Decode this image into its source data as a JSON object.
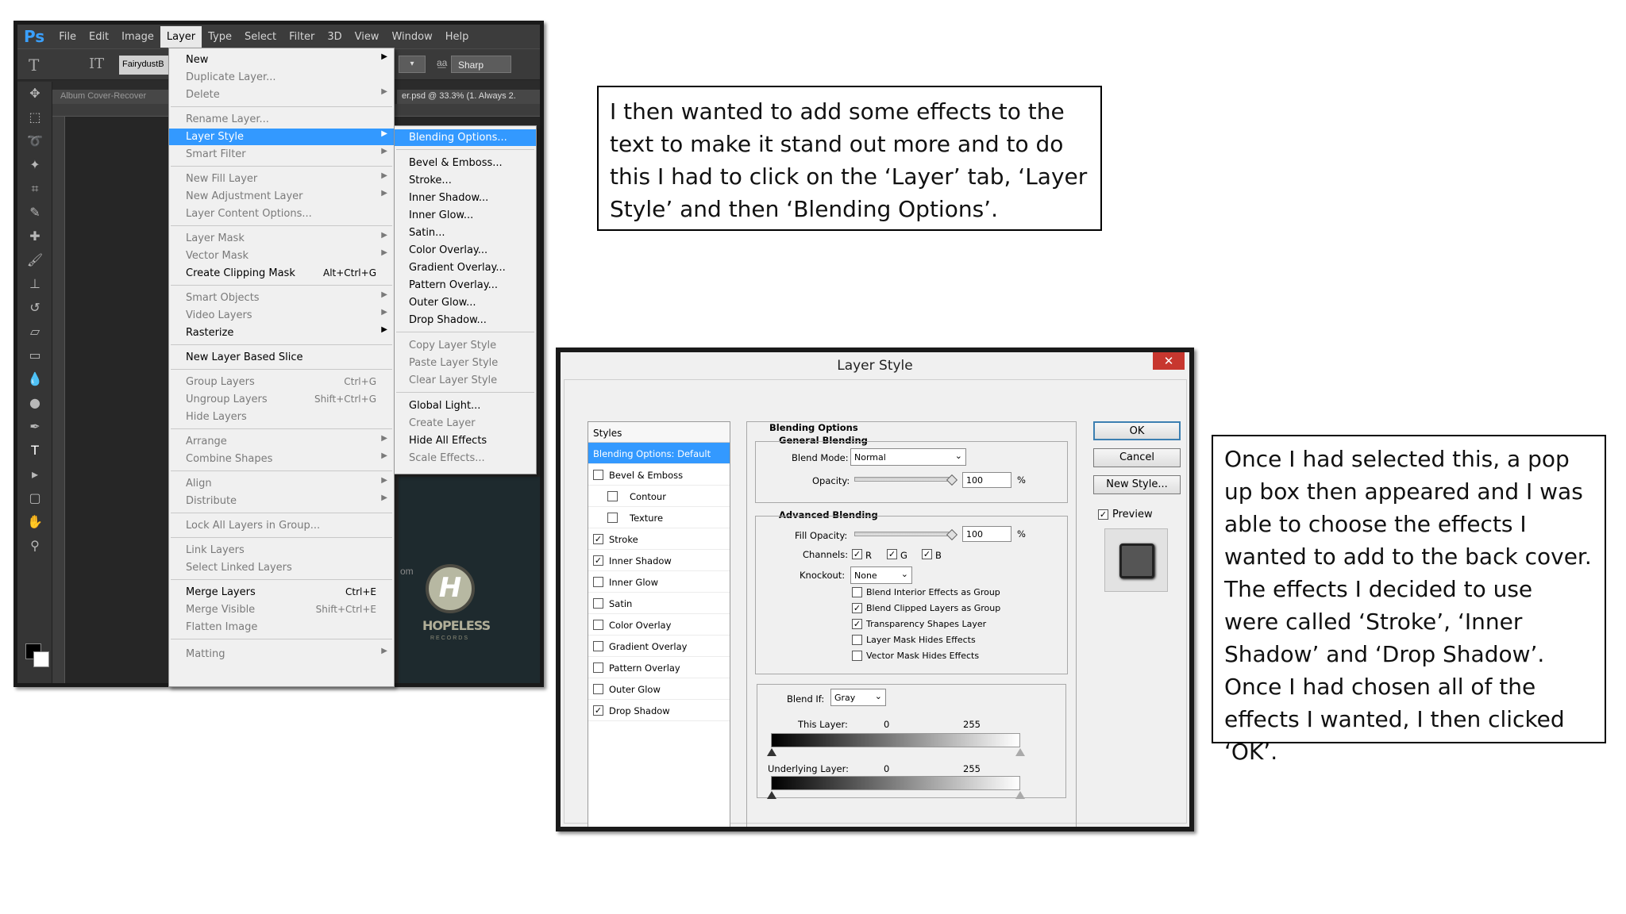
{
  "photoshop": {
    "app_logo": "Ps",
    "menubar": [
      "File",
      "Edit",
      "Image",
      "Layer",
      "Type",
      "Select",
      "Filter",
      "3D",
      "View",
      "Window",
      "Help"
    ],
    "active_menu": "Layer",
    "options": {
      "font": "FairydustB",
      "aa_label": "aa",
      "antialias": "Sharp"
    },
    "doc_tab_left": "Album Cover-Recover",
    "doc_tab_right": "er.psd @ 33.3% (1. Always 2.",
    "canvas_fragment": "om",
    "logo_letter": "H",
    "logo_text": "HOPELESS",
    "logo_subtext": "RECORDS"
  },
  "layer_menu": {
    "items": [
      {
        "label": "New",
        "disabled": false,
        "submenu": true
      },
      {
        "label": "Duplicate Layer...",
        "disabled": true
      },
      {
        "label": "Delete",
        "disabled": true,
        "submenu": true
      },
      {
        "label": "Rename Layer...",
        "disabled": true
      },
      {
        "label": "Layer Style",
        "disabled": false,
        "submenu": true,
        "highlighted": true
      },
      {
        "label": "Smart Filter",
        "disabled": true,
        "submenu": true
      },
      {
        "label": "New Fill Layer",
        "disabled": true,
        "submenu": true
      },
      {
        "label": "New Adjustment Layer",
        "disabled": true,
        "submenu": true
      },
      {
        "label": "Layer Content Options...",
        "disabled": true
      },
      {
        "label": "Layer Mask",
        "disabled": true,
        "submenu": true
      },
      {
        "label": "Vector Mask",
        "disabled": true,
        "submenu": true
      },
      {
        "label": "Create Clipping Mask",
        "disabled": false,
        "shortcut": "Alt+Ctrl+G"
      },
      {
        "label": "Smart Objects",
        "disabled": true,
        "submenu": true
      },
      {
        "label": "Video Layers",
        "disabled": true,
        "submenu": true
      },
      {
        "label": "Rasterize",
        "disabled": false,
        "submenu": true
      },
      {
        "label": "New Layer Based Slice",
        "disabled": false
      },
      {
        "label": "Group Layers",
        "disabled": true,
        "shortcut": "Ctrl+G"
      },
      {
        "label": "Ungroup Layers",
        "disabled": true,
        "shortcut": "Shift+Ctrl+G"
      },
      {
        "label": "Hide Layers",
        "disabled": true
      },
      {
        "label": "Arrange",
        "disabled": true,
        "submenu": true
      },
      {
        "label": "Combine Shapes",
        "disabled": true,
        "submenu": true
      },
      {
        "label": "Align",
        "disabled": true,
        "submenu": true
      },
      {
        "label": "Distribute",
        "disabled": true,
        "submenu": true
      },
      {
        "label": "Lock All Layers in Group...",
        "disabled": true
      },
      {
        "label": "Link Layers",
        "disabled": true
      },
      {
        "label": "Select Linked Layers",
        "disabled": true
      },
      {
        "label": "Merge Layers",
        "disabled": false,
        "shortcut": "Ctrl+E"
      },
      {
        "label": "Merge Visible",
        "disabled": true,
        "shortcut": "Shift+Ctrl+E"
      },
      {
        "label": "Flatten Image",
        "disabled": true
      },
      {
        "label": "Matting",
        "disabled": true,
        "submenu": true
      }
    ]
  },
  "style_menu": {
    "items": [
      {
        "label": "Blending Options...",
        "disabled": false,
        "highlighted": true
      },
      {
        "label": "Bevel & Emboss...",
        "disabled": false
      },
      {
        "label": "Stroke...",
        "disabled": false
      },
      {
        "label": "Inner Shadow...",
        "disabled": false
      },
      {
        "label": "Inner Glow...",
        "disabled": false
      },
      {
        "label": "Satin...",
        "disabled": false
      },
      {
        "label": "Color Overlay...",
        "disabled": false
      },
      {
        "label": "Gradient Overlay...",
        "disabled": false
      },
      {
        "label": "Pattern Overlay...",
        "disabled": false
      },
      {
        "label": "Outer Glow...",
        "disabled": false
      },
      {
        "label": "Drop Shadow...",
        "disabled": false
      },
      {
        "label": "Copy Layer Style",
        "disabled": true
      },
      {
        "label": "Paste Layer Style",
        "disabled": true
      },
      {
        "label": "Clear Layer Style",
        "disabled": true
      },
      {
        "label": "Global Light...",
        "disabled": false
      },
      {
        "label": "Create Layer",
        "disabled": true
      },
      {
        "label": "Hide All Effects",
        "disabled": false
      },
      {
        "label": "Scale Effects...",
        "disabled": true
      }
    ]
  },
  "note1": "I then wanted to add some effects to the text to make it stand out more and to do this I had to click on the ‘Layer’ tab, ‘Layer Style’ and then ‘Blending Options’.",
  "note2": "Once I had selected this, a pop up box then appeared and I was able to choose the effects I wanted to add to the back cover. The effects I decided to use were called ‘Stroke’, ‘Inner Shadow’ and ‘Drop Shadow’. Once I had chosen all of the effects I wanted, I then clicked ‘OK’.",
  "dialog": {
    "title": "Layer Style",
    "close": "✕",
    "styles_header": "Styles",
    "styles": [
      {
        "label": "Blending Options: Default",
        "selected": true
      },
      {
        "label": "Bevel & Emboss",
        "checked": false
      },
      {
        "label": "Contour",
        "checked": false,
        "indent": true
      },
      {
        "label": "Texture",
        "checked": false,
        "indent": true
      },
      {
        "label": "Stroke",
        "checked": true
      },
      {
        "label": "Inner Shadow",
        "checked": true
      },
      {
        "label": "Inner Glow",
        "checked": false
      },
      {
        "label": "Satin",
        "checked": false
      },
      {
        "label": "Color Overlay",
        "checked": false
      },
      {
        "label": "Gradient Overlay",
        "checked": false
      },
      {
        "label": "Pattern Overlay",
        "checked": false
      },
      {
        "label": "Outer Glow",
        "checked": false
      },
      {
        "label": "Drop Shadow",
        "checked": true
      }
    ],
    "blending_options": "Blending Options",
    "general_blending": "General Blending",
    "blend_mode_label": "Blend Mode:",
    "blend_mode": "Normal",
    "opacity_label": "Opacity:",
    "opacity": "100",
    "percent": "%",
    "advanced_blending": "Advanced Blending",
    "fill_opacity_label": "Fill Opacity:",
    "fill_opacity": "100",
    "channels_label": "Channels:",
    "channels": [
      "R",
      "G",
      "B"
    ],
    "knockout_label": "Knockout:",
    "knockout": "None",
    "adv_checks": [
      {
        "label": "Blend Interior Effects as Group",
        "checked": false
      },
      {
        "label": "Blend Clipped Layers as Group",
        "checked": true
      },
      {
        "label": "Transparency Shapes Layer",
        "checked": true
      },
      {
        "label": "Layer Mask Hides Effects",
        "checked": false
      },
      {
        "label": "Vector Mask Hides Effects",
        "checked": false
      }
    ],
    "blend_if_label": "Blend If:",
    "blend_if": "Gray",
    "this_layer_label": "This Layer:",
    "underlying_label": "Underlying Layer:",
    "range_low": "0",
    "range_high": "255",
    "ok": "OK",
    "cancel": "Cancel",
    "new_style": "New Style...",
    "preview": "Preview",
    "check": "✓"
  }
}
